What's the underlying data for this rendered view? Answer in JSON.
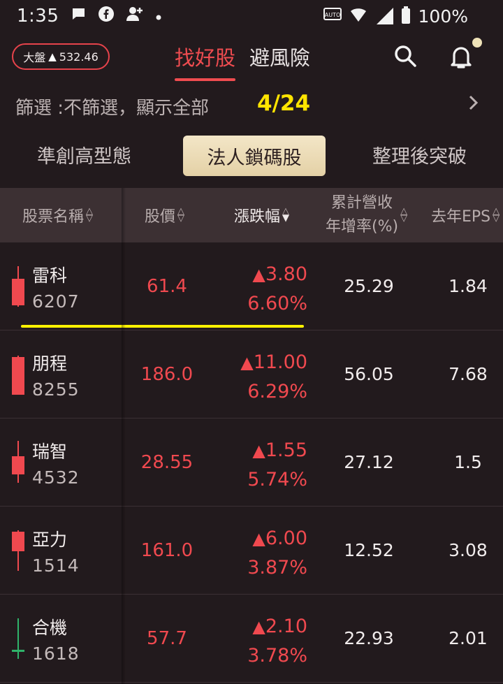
{
  "status": {
    "time": "1:35",
    "battery": "100%"
  },
  "header": {
    "index_label": "大盤",
    "index_value": "532.46",
    "tabs": [
      "找好股",
      "避風險"
    ]
  },
  "filter": {
    "label": "篩選 :不篩選，顯示全部",
    "date": "4/24"
  },
  "categories": [
    "準創高型態",
    "法人鎖碼股",
    "整理後突破"
  ],
  "table": {
    "headers": {
      "name": "股票名稱",
      "price": "股價",
      "change": "漲跌幅",
      "revenue_l1": "累計營收",
      "revenue_l2": "年增率(%)",
      "eps": "去年EPS"
    },
    "rows": [
      {
        "name": "雷科",
        "code": "6207",
        "price": "61.4",
        "change": "3.80",
        "pct": "6.60%",
        "revenue": "25.29",
        "eps": "1.84"
      },
      {
        "name": "朋程",
        "code": "8255",
        "price": "186.0",
        "change": "11.00",
        "pct": "6.29%",
        "revenue": "56.05",
        "eps": "7.68"
      },
      {
        "name": "瑞智",
        "code": "4532",
        "price": "28.55",
        "change": "1.55",
        "pct": "5.74%",
        "revenue": "27.12",
        "eps": "1.5"
      },
      {
        "name": "亞力",
        "code": "1514",
        "price": "161.0",
        "change": "6.00",
        "pct": "3.87%",
        "revenue": "12.52",
        "eps": "3.08"
      },
      {
        "name": "合機",
        "code": "1618",
        "price": "57.7",
        "change": "2.10",
        "pct": "3.78%",
        "revenue": "22.93",
        "eps": "2.01"
      }
    ]
  },
  "colors": {
    "up": "#f0494f",
    "accent": "#ef4c50",
    "highlight": "#ffe400",
    "candle_down": "#2fb36a"
  },
  "icons": [
    "search-icon",
    "bell-icon",
    "chevron-right-icon",
    "sort-icon"
  ]
}
